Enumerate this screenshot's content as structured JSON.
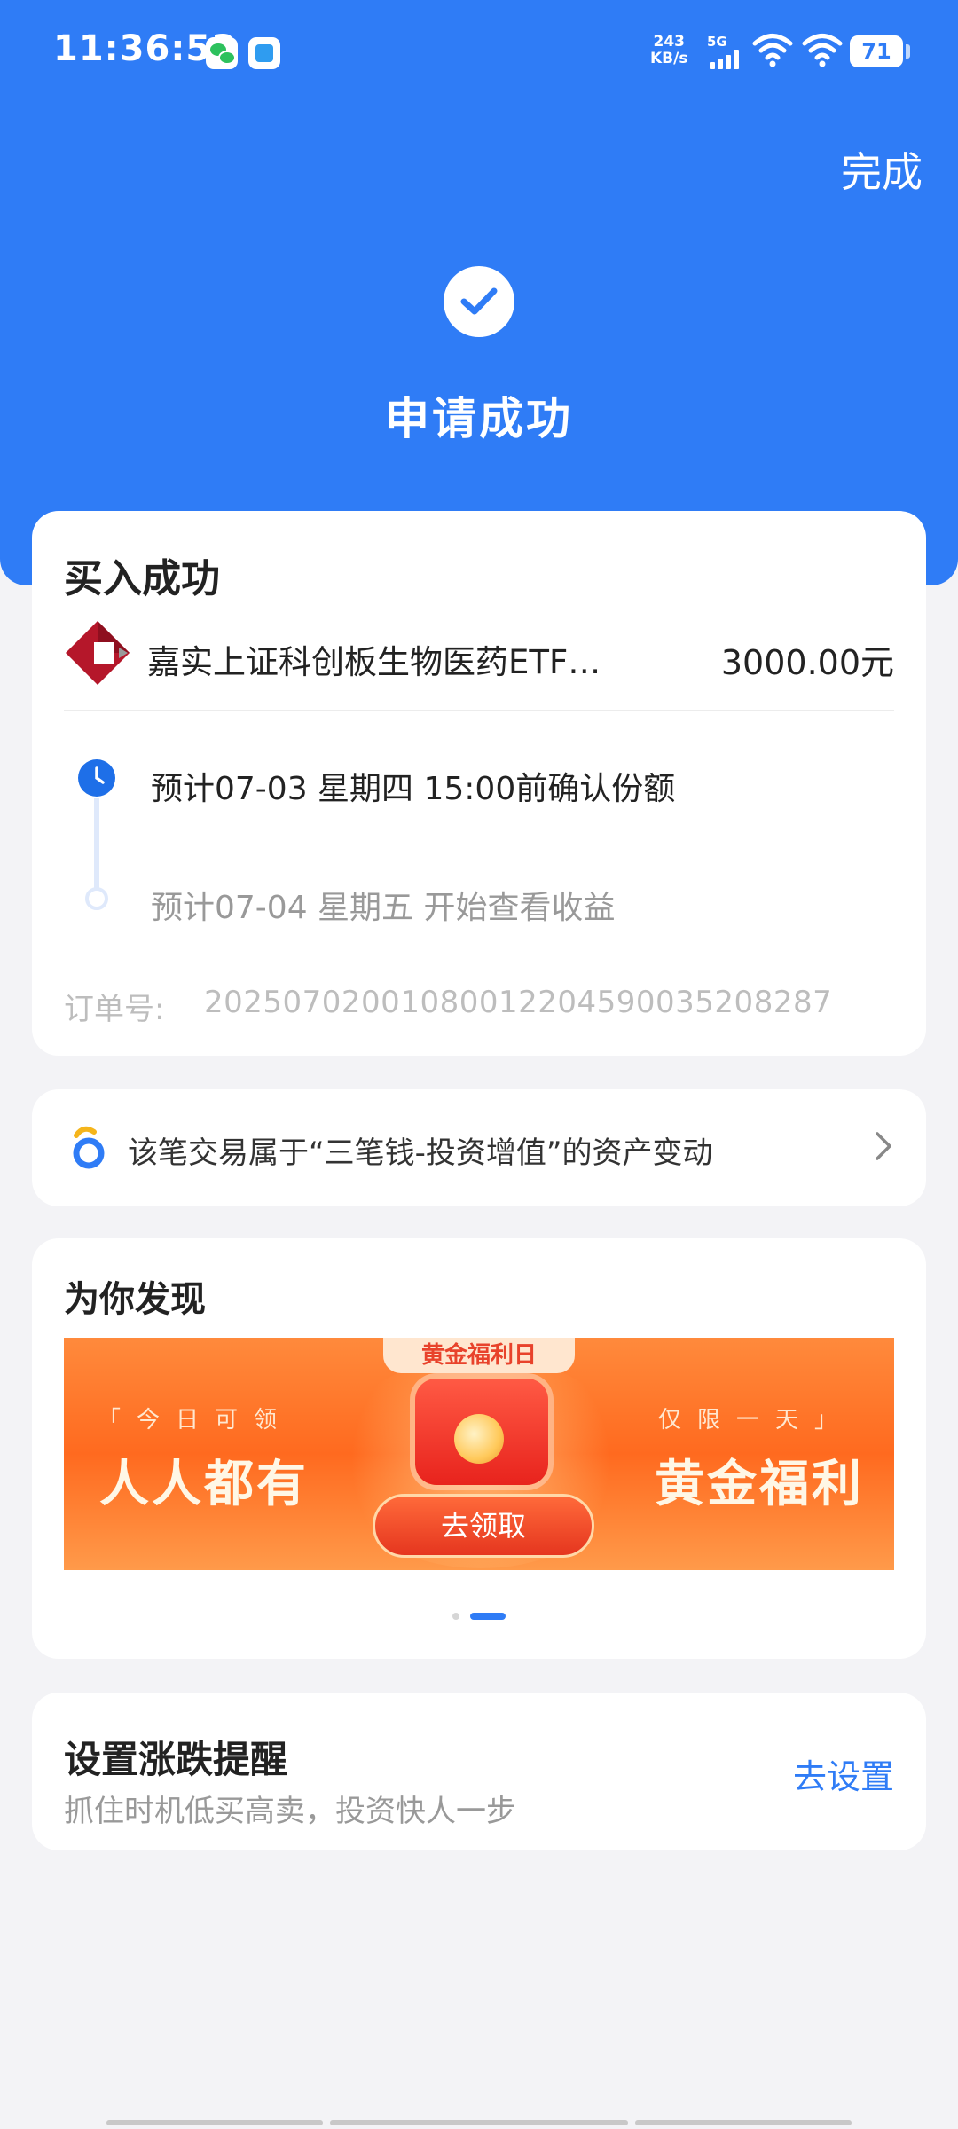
{
  "status_bar": {
    "time": "11:36:53",
    "net_speed_value": "243",
    "net_speed_unit": "KB/s",
    "network_type": "5G",
    "battery": "71"
  },
  "header": {
    "done_label": "完成",
    "title": "申请成功"
  },
  "order": {
    "title": "买入成功",
    "fund_name": "嘉实上证科创板生物医药ETF…",
    "amount": "3000.00元",
    "timeline": [
      {
        "text": "预计07-03 星期四 15:00前确认份额"
      },
      {
        "text": "预计07-04 星期五 开始查看收益"
      }
    ],
    "order_no_label": "订单号:",
    "order_no": "2025070200108001220459003520828​7"
  },
  "asset_notice": {
    "text": "该笔交易属于“三笔钱-投资增值”的资产变动"
  },
  "discover": {
    "title": "为你发现",
    "banner": {
      "tag": "黄金福利日",
      "left_small": "「今日可领",
      "left_big": "人人都有",
      "right_small": "仅限一天」",
      "right_big": "黄金福利",
      "button": "去领取"
    }
  },
  "alert": {
    "title": "设置涨跌提醒",
    "subtitle": "抓住时机低买高卖，投资快人一步",
    "link": "去设置"
  },
  "colors": {
    "brand_blue": "#2f7cf6",
    "background": "#f3f3f6"
  }
}
